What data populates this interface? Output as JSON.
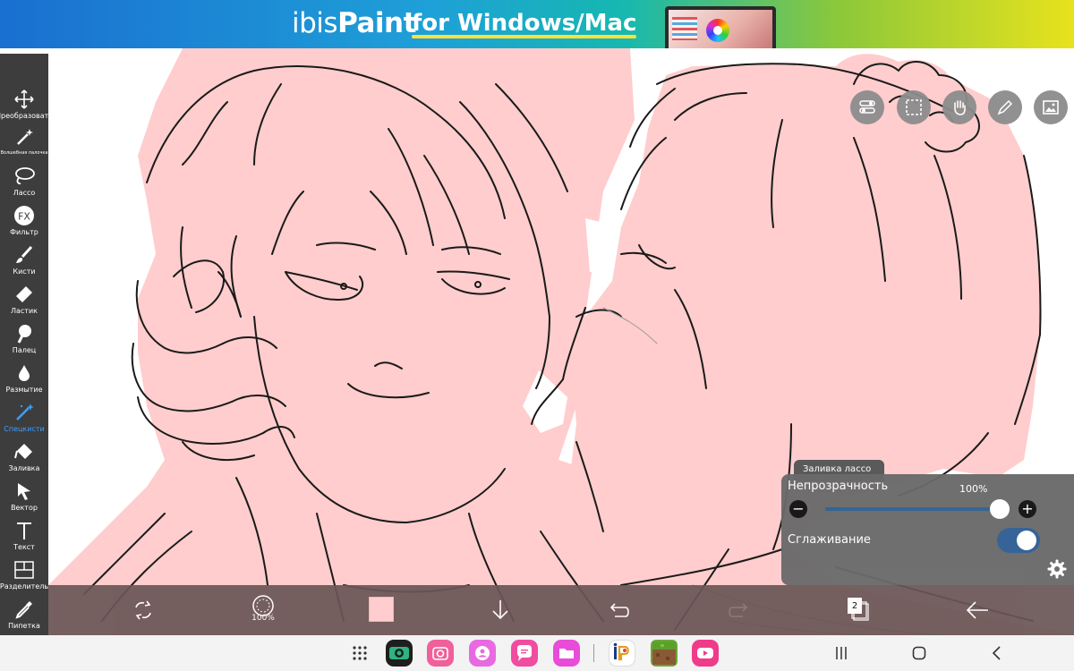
{
  "banner": {
    "logo_text_1": "ibis",
    "logo_text_2": "Paint",
    "tagline": "for Windows/Mac"
  },
  "toolbar": {
    "tools": [
      {
        "id": "transform",
        "label": "Преобразовать",
        "icon": "move-arrows-icon"
      },
      {
        "id": "magic-wand",
        "label": "Волшебная палочка",
        "icon": "magic-wand-icon"
      },
      {
        "id": "lasso",
        "label": "Лассо",
        "icon": "lasso-icon"
      },
      {
        "id": "filter",
        "label": "Фильтр",
        "icon": "fx-icon"
      },
      {
        "id": "brush",
        "label": "Кисти",
        "icon": "brush-icon"
      },
      {
        "id": "eraser",
        "label": "Ластик",
        "icon": "eraser-icon"
      },
      {
        "id": "finger",
        "label": "Палец",
        "icon": "finger-smudge-icon"
      },
      {
        "id": "blur",
        "label": "Размытие",
        "icon": "drop-icon"
      },
      {
        "id": "special",
        "label": "Спецкисти",
        "icon": "special-brush-icon"
      },
      {
        "id": "fill",
        "label": "Заливка",
        "icon": "fill-bucket-icon"
      },
      {
        "id": "vector",
        "label": "Вектор",
        "icon": "vector-arrow-icon"
      },
      {
        "id": "text",
        "label": "Текст",
        "icon": "text-icon"
      },
      {
        "id": "divider",
        "label": "Разделитель",
        "icon": "frame-divider-icon"
      },
      {
        "id": "eyedropper",
        "label": "Пипетка",
        "icon": "eyedropper-icon"
      }
    ],
    "active_tool": "special"
  },
  "canvas_buttons": [
    "toggle-panel-icon",
    "selection-icon",
    "hand-icon",
    "pen-icon",
    "image-icon"
  ],
  "lasso_panel": {
    "tab_title": "Заливка лассо",
    "opacity_label": "Непрозрачность",
    "opacity_value": "100%",
    "opacity": 1.0,
    "minus": "−",
    "plus": "+",
    "smoothing_label": "Сглаживание",
    "smoothing_on": true
  },
  "bottom_toolbar": {
    "brush_size": "100%",
    "current_color": "#ffcdcd",
    "layer_count": "2"
  },
  "navbar": {
    "apps": [
      "camera-icon",
      "camera-app-icon",
      "contacts-icon",
      "messages-icon",
      "files-icon",
      "ibispaint-icon",
      "minecraft-icon",
      "youtube-icon"
    ]
  },
  "colors": {
    "toolbar_bg": "#3d3d3d",
    "accent_blue": "#3aa0ff",
    "skin_fill": "#ffcdcd",
    "panel_bg": "#6a6a6a",
    "bottom_bar_bg": "#6b5656"
  }
}
